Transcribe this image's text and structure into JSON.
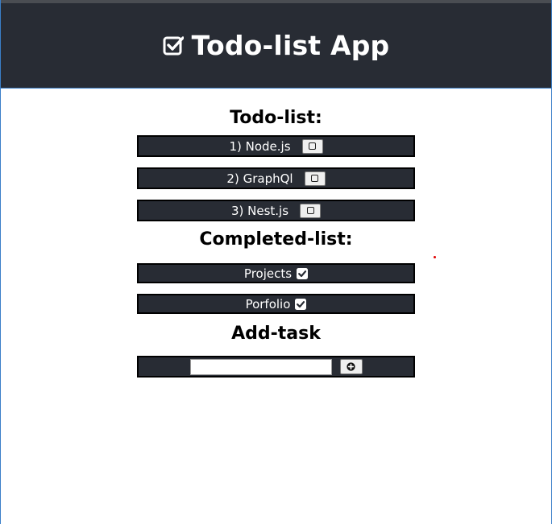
{
  "app": {
    "title": "Todo-list App",
    "icon": "checkbox-checked-icon"
  },
  "todo": {
    "heading": "Todo-list:",
    "items": [
      {
        "label": "1) Node.js",
        "action_icon": "square-icon"
      },
      {
        "label": "2) GraphQl",
        "action_icon": "square-icon"
      },
      {
        "label": "3) Nest.js",
        "action_icon": "square-icon"
      }
    ]
  },
  "completed": {
    "heading": "Completed-list:",
    "items": [
      {
        "label": "Projects",
        "icon": "checkbox-checked-icon"
      },
      {
        "label": "Porfolio",
        "icon": "checkbox-checked-icon"
      }
    ]
  },
  "add_task": {
    "heading": "Add-task",
    "input_value": "",
    "placeholder": "",
    "button_icon": "plus-circle-icon"
  },
  "colors": {
    "header_bg": "#282c34",
    "row_bg": "#282c34",
    "text_light": "#ffffff",
    "accent_border": "#3a7fc8"
  }
}
